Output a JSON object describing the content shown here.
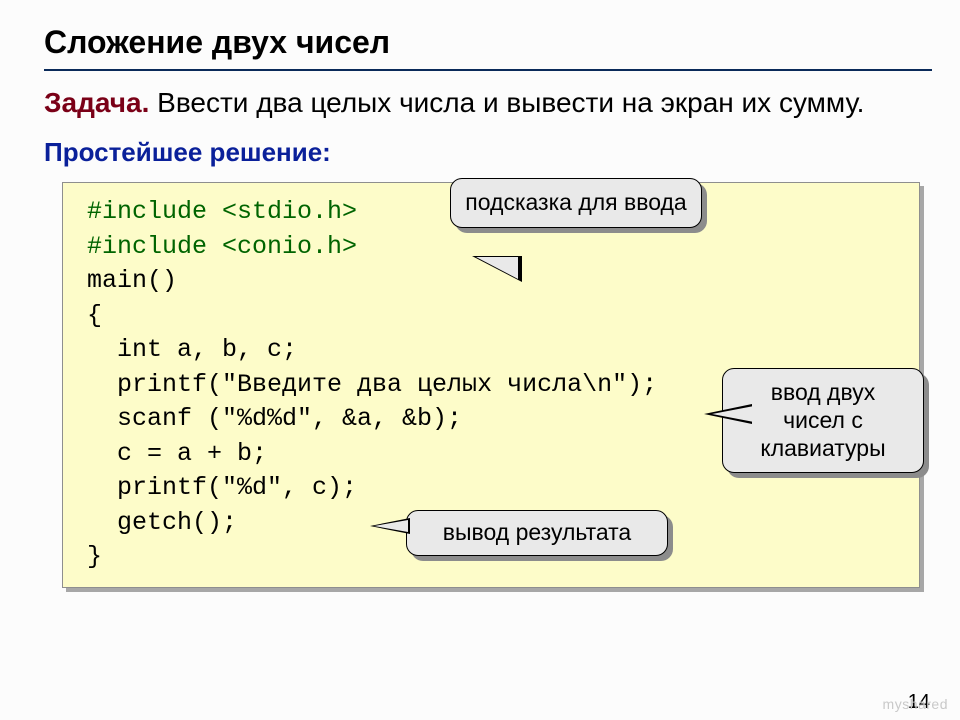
{
  "title": "Сложение двух чисел",
  "task": {
    "label": "Задача.",
    "text": " Ввести два целых числа и вывести на экран их сумму."
  },
  "solution_label": "Простейшее решение:",
  "code": {
    "l1a": "#include ",
    "l1b": "<stdio.h>",
    "l2a": "#include ",
    "l2b": "<conio.h>",
    "l3": "main()",
    "l4": "{",
    "l5": "  int a, b, c;",
    "l6": "  printf(\"Введите два целых числа\\n\");",
    "l7": "  scanf (\"%d%d\", &a, &b);",
    "l8": "  c = a + b;",
    "l9": "  printf(\"%d\", c);",
    "l10": "  getch();",
    "l11": "}"
  },
  "callouts": {
    "c1": "подсказка для ввода",
    "c2": "ввод двух чисел с клавиатуры",
    "c3": "вывод результата"
  },
  "page_number": "14",
  "watermark": "myshared"
}
